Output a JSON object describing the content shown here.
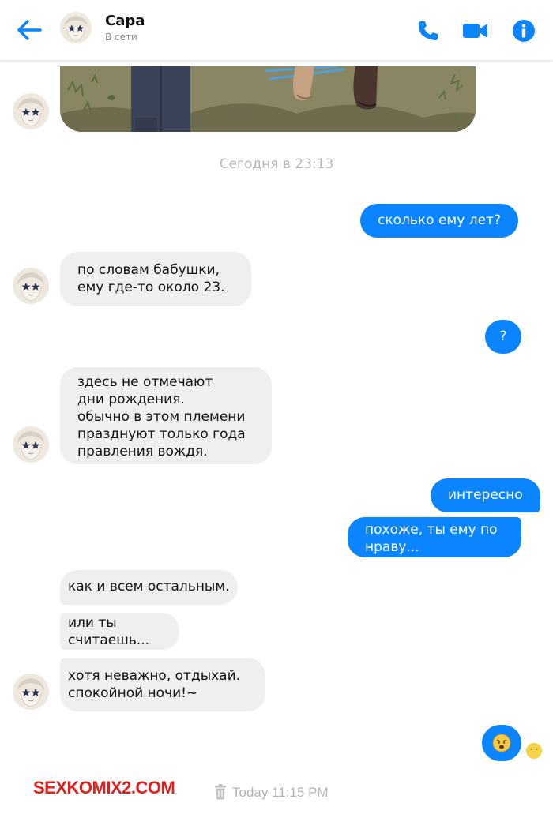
{
  "header": {
    "contact_name": "Сара",
    "status": "В сети"
  },
  "messages": {
    "timestamp": "Сегодня в 23:13",
    "m1": "сколько ему лет?",
    "m2": "по словам бабушки,\nему где-то около 23.",
    "m3": "?",
    "m4": "здесь не отмечают\nдни рождения.\nобычно в этом племени\nпразднуют только года\nправления вождя.",
    "m5": "интересно",
    "m6": "похоже, ты ему по\nнраву...",
    "m7": "как и всем остальным.",
    "m8": "или ты\nсчитаешь...",
    "m9": "хотя неважно, отдыхай.\nспокойной ночи!~",
    "m10_emoji": "sad-face-emoji"
  },
  "footer": {
    "watermark_a": "SEX",
    "watermark_b": "KOMIX2.COM",
    "time": "Today 11:15 PM"
  },
  "colors": {
    "accent": "#0a84ff",
    "incoming_bubble": "#efeff0",
    "muted_text": "#b5b8bd"
  },
  "icons": {
    "back": "back-arrow-icon",
    "call": "phone-icon",
    "video": "video-camera-icon",
    "info": "info-icon",
    "trash": "trash-icon"
  }
}
